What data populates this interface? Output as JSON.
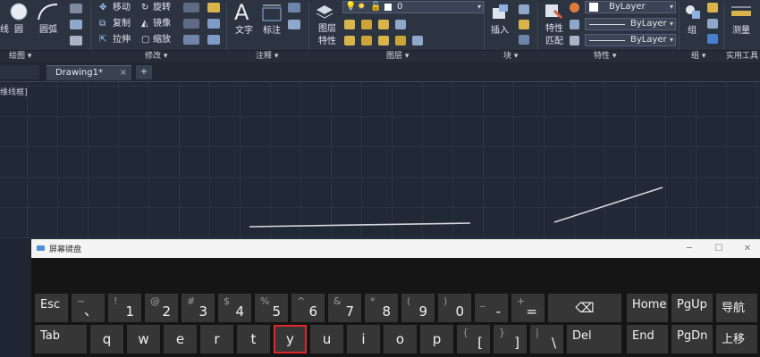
{
  "ribbon": {
    "draw_panel": {
      "polyline_partial": "线",
      "circle": "圆",
      "arc": "圆弧",
      "label": "绘图 ▾"
    },
    "modify_panel": {
      "move": "移动",
      "rotate": "旋转",
      "copy": "复制",
      "mirror": "镜像",
      "stretch": "拉伸",
      "scale": "缩放",
      "label": "修改 ▾"
    },
    "annotation_panel": {
      "text": "文字",
      "dimension": "标注",
      "label": "注释 ▾"
    },
    "layers_panel": {
      "layer_props_line1": "图层",
      "layer_props_line2": "特性",
      "current_layer": "0",
      "label": "图层 ▾"
    },
    "block_panel": {
      "insert": "插入",
      "label": "块 ▾"
    },
    "properties_panel": {
      "match_line1": "特性",
      "match_line2": "匹配",
      "color": "ByLayer",
      "linetype": "ByLayer",
      "lineweight": "ByLayer",
      "label": "特性 ▾"
    },
    "groups_panel": {
      "group": "组",
      "label": "组 ▾"
    },
    "utilities_panel": {
      "measure": "测量",
      "label": "实用工具"
    }
  },
  "tabs": {
    "drawing": "Drawing1*",
    "close": "×",
    "add": "+"
  },
  "canvas": {
    "viewport_label": "维线框]"
  },
  "osk": {
    "title": "屏幕键盘",
    "minimize": "─",
    "maximize": "☐",
    "close": "✕",
    "selected_key": "y",
    "row1": [
      {
        "label": "Esc"
      },
      {
        "top": "~",
        "bot": "、"
      },
      {
        "top": "!",
        "bot": "1"
      },
      {
        "top": "@",
        "bot": "2"
      },
      {
        "top": "#",
        "bot": "3"
      },
      {
        "top": "$",
        "bot": "4"
      },
      {
        "top": "%",
        "bot": "5"
      },
      {
        "top": "^",
        "bot": "6"
      },
      {
        "top": "&",
        "bot": "7"
      },
      {
        "top": "*",
        "bot": "8"
      },
      {
        "top": "(",
        "bot": "9"
      },
      {
        "top": ")",
        "bot": "0"
      },
      {
        "top": "_",
        "bot": "-"
      },
      {
        "top": "+",
        "bot": "="
      },
      {
        "label": "⌫"
      }
    ],
    "row1_right": [
      "Home",
      "PgUp",
      "导航"
    ],
    "row2": [
      {
        "label": "Tab"
      },
      {
        "label": "q"
      },
      {
        "label": "w"
      },
      {
        "label": "e"
      },
      {
        "label": "r"
      },
      {
        "label": "t"
      },
      {
        "label": "y"
      },
      {
        "label": "u"
      },
      {
        "label": "i"
      },
      {
        "label": "o"
      },
      {
        "label": "p"
      },
      {
        "top": "{",
        "bot": "["
      },
      {
        "top": "}",
        "bot": "]"
      },
      {
        "top": "|",
        "bot": "\\"
      },
      {
        "label": "Del"
      }
    ],
    "row2_right": [
      "End",
      "PgDn",
      "上移"
    ]
  },
  "colors": {
    "ribbon_bg": "#2c3442",
    "canvas_bg": "#212836",
    "key_bg": "#363636",
    "selection": "#e0282a"
  }
}
